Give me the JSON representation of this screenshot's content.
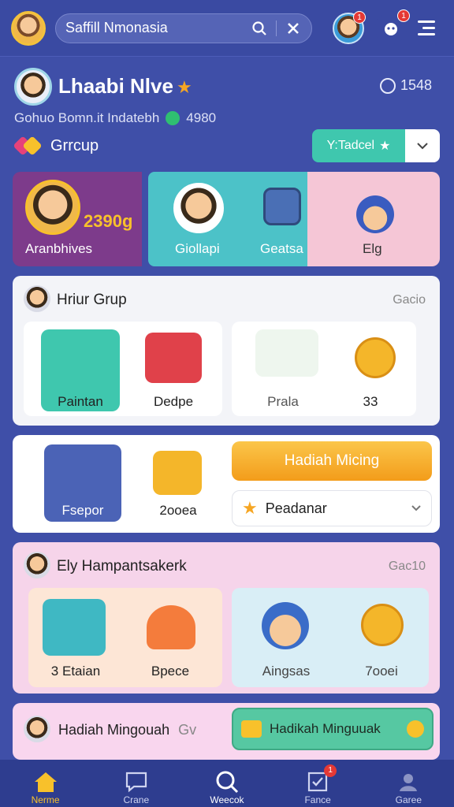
{
  "search": {
    "value": "Saffill Nmonasia"
  },
  "header_badges": {
    "profile_badge": "1",
    "bot_badge": "1"
  },
  "profile": {
    "name": "Lhaabi Nlve",
    "points": "1548",
    "subtitle": "Gohuo Bomn.it Indatebh",
    "coins": "4980",
    "group_label": "Grrcup",
    "group_button": "Y:Tadcel"
  },
  "banner": {
    "left_amount": "2390g",
    "left_caption": "Aranbhives",
    "mid_caption_1": "Giollapi",
    "mid_caption_2": "Geatsa",
    "right_caption": "Elg"
  },
  "card1": {
    "title": "Hriur Grup",
    "right": "Gacio",
    "tiles": [
      {
        "label": "Paintan"
      },
      {
        "label": "Dedpe"
      },
      {
        "label": "Prala"
      },
      {
        "label": "33"
      }
    ]
  },
  "card2": {
    "tiles": [
      {
        "label": "Fsepor"
      },
      {
        "label": "2ooea"
      }
    ],
    "action_button": "Hadiah Micing",
    "dropdown_value": "Peadanar"
  },
  "card3": {
    "title": "Ely Hampantsakerk",
    "right": "Gac10",
    "tiles": [
      {
        "label": "Etaian",
        "prefix": "3"
      },
      {
        "label": "Bpece"
      },
      {
        "label": "Aingsas"
      },
      {
        "label": "7ooei"
      }
    ]
  },
  "card4": {
    "left_text": "Hadiah Mingouah",
    "left_suffix": "Gv",
    "right_button": "Hadikah Minguuak"
  },
  "nav": {
    "items": [
      {
        "label": "Nerme",
        "icon": "home-icon"
      },
      {
        "label": "Crane",
        "icon": "chat-icon"
      },
      {
        "label": "Weecok",
        "icon": "search-icon"
      },
      {
        "label": "Fance",
        "icon": "checklist-icon"
      },
      {
        "label": "Garee",
        "icon": "profile-icon"
      }
    ],
    "badge": "1"
  },
  "colors": {
    "background": "#3f4fa8",
    "accent_yellow": "#f8c12b",
    "teal": "#3fc7ae",
    "purple": "#7d3b8b",
    "pink": "#f5c6d6"
  }
}
